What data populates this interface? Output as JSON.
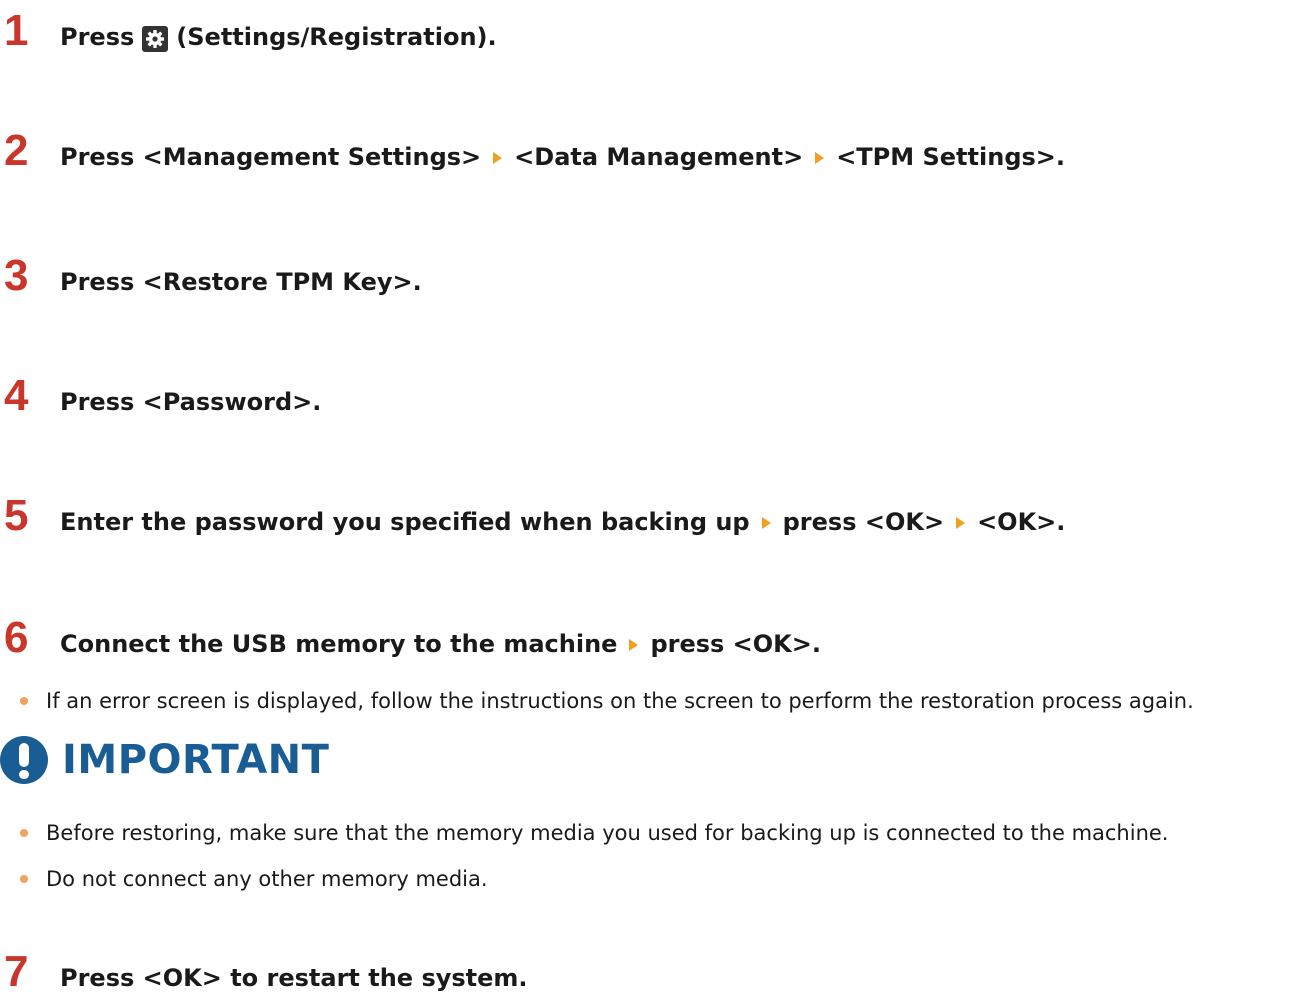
{
  "steps": [
    {
      "num": "1",
      "parts": [
        "Press",
        "(Settings/Registration)."
      ]
    },
    {
      "num": "2",
      "parts": [
        "Press <Management Settings>",
        "<Data Management>",
        "<TPM Settings>."
      ]
    },
    {
      "num": "3",
      "parts": [
        "Press <Restore TPM Key>."
      ]
    },
    {
      "num": "4",
      "parts": [
        "Press <Password>."
      ]
    },
    {
      "num": "5",
      "parts": [
        "Enter the password you specified when backing up",
        "press <OK>",
        "<OK>."
      ]
    },
    {
      "num": "6",
      "parts": [
        "Connect the USB memory to the machine",
        "press <OK>."
      ]
    },
    {
      "num": "7",
      "parts": [
        "Press <OK> to restart the system."
      ]
    }
  ],
  "step6_note": "If an error screen is displayed, follow the instructions on the screen to perform the restoration process again.",
  "important": {
    "title": "IMPORTANT",
    "items": [
      "Before restoring, make sure that the memory media you used for backing up is connected to the machine.",
      "Do not connect any other memory media."
    ]
  },
  "icons": {
    "settings": "gear-icon",
    "arrow": "triangle-right-icon",
    "important": "exclamation-icon"
  },
  "colors": {
    "step_number": "#c9362c",
    "arrow": "#f0a020",
    "bullet": "#f2a25c",
    "important": "#1a5d94"
  }
}
